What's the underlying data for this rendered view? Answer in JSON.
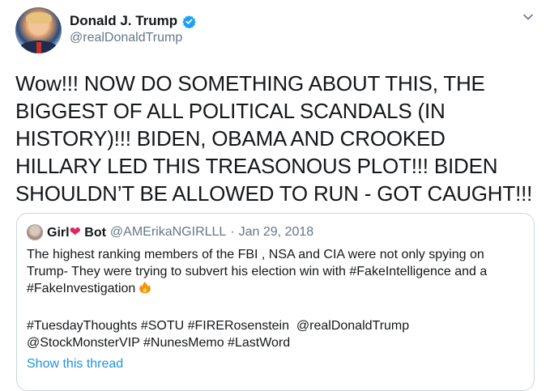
{
  "author": {
    "display_name": "Donald J. Trump",
    "handle": "@realDonaldTrump",
    "verified": true
  },
  "tweet": {
    "text": "Wow!!! NOW DO SOMETHING ABOUT THIS, THE BIGGEST OF ALL POLITICAL SCANDALS (IN HISTORY)!!! BIDEN, OBAMA AND CROOKED HILLARY LED THIS TREASONOUS PLOT!!! BIDEN SHOULDN’T BE ALLOWED TO RUN - GOT CAUGHT!!!"
  },
  "quoted_tweet": {
    "name_part1": "Girl",
    "heart": "❤",
    "name_part2": "Bot",
    "handle": "@AMErikaNGIRLLL",
    "separator": "·",
    "date": "Jan 29, 2018",
    "text": "The highest ranking members of the FBI , NSA and CIA were not only spying on Trump- They were trying to subvert his election win with #FakeIntelligence and a #FakeInvestigation",
    "hashtags_line1": "#TuesdayThoughts #SOTU #FIRERosenstein  @realDonaldTrump",
    "hashtags_line2": "@StockMonsterVIP #NunesMemo #LastWord",
    "show_thread": "Show this thread"
  },
  "icons": {
    "verified": "verified-badge-icon",
    "caret": "chevron-down-icon",
    "fire": "fire-emoji-icon"
  },
  "colors": {
    "link_blue": "#1b95e0",
    "verified_blue": "#1da1f2",
    "secondary_text": "#657786",
    "border": "#ccd6dd",
    "heart_red": "#e0245e"
  }
}
